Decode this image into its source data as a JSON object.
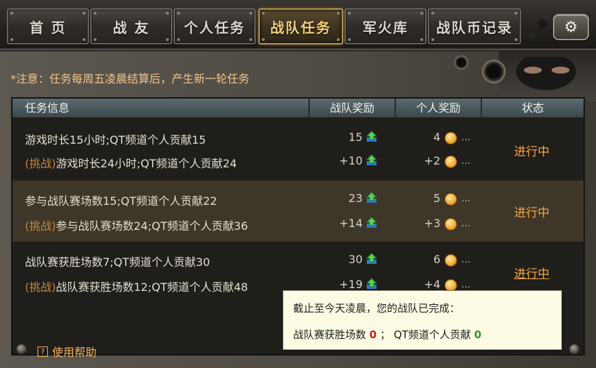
{
  "tabs": [
    {
      "label": "首 页"
    },
    {
      "label": "战 友"
    },
    {
      "label": "个人任务"
    },
    {
      "label": "战队任务"
    },
    {
      "label": "军火库"
    },
    {
      "label": "战队币记录"
    }
  ],
  "active_tab": "战队任务",
  "notice": "*注意：任务每周五凌晨结算后，产生新一轮任务",
  "table": {
    "headers": {
      "info": "任务信息",
      "team_reward": "战队奖励",
      "personal_reward": "个人奖励",
      "status": "状态"
    },
    "rows": [
      {
        "task": "游戏时长15小时;QT频道个人贡献15",
        "challenge_tag": "(挑战)",
        "challenge": "游戏时长24小时;QT频道个人贡献24",
        "team_reward": "15",
        "team_bonus": "+10",
        "personal_reward": "4",
        "personal_bonus": "+2",
        "more": "...",
        "status": "进行中"
      },
      {
        "task": "参与战队赛场数15;QT频道个人贡献22",
        "challenge_tag": "(挑战)",
        "challenge": "参与战队赛场数24;QT频道个人贡献36",
        "team_reward": "23",
        "team_bonus": "+14",
        "personal_reward": "5",
        "personal_bonus": "+3",
        "more": "...",
        "status": "进行中"
      },
      {
        "task": "战队赛获胜场数7;QT频道个人贡献30",
        "challenge_tag": "(挑战)",
        "challenge": "战队赛获胜场数12;QT频道个人贡献48",
        "team_reward": "30",
        "team_bonus": "+19",
        "personal_reward": "6",
        "personal_bonus": "+4",
        "more": "...",
        "status": "进行中"
      }
    ]
  },
  "tooltip": {
    "line1": "截止至今天凌晨，您的战队已完成：",
    "label_wins": "战队赛获胜场数",
    "value_wins": "0",
    "separator": "；",
    "label_contrib": "QT频道个人贡献",
    "value_contrib": "0"
  },
  "help": {
    "icon": "?",
    "label": "使用帮助"
  },
  "icons": {
    "settings": "gear-icon",
    "team_reward": "green-up-arrow-icon",
    "personal_reward": "gold-coin-icon"
  },
  "colors": {
    "accent": "#f4a646",
    "active_tab_text": "#f4d27a",
    "challenge_tag": "#c8873c",
    "red_value": "#c41c1c",
    "green_value": "#2c9a2c"
  }
}
